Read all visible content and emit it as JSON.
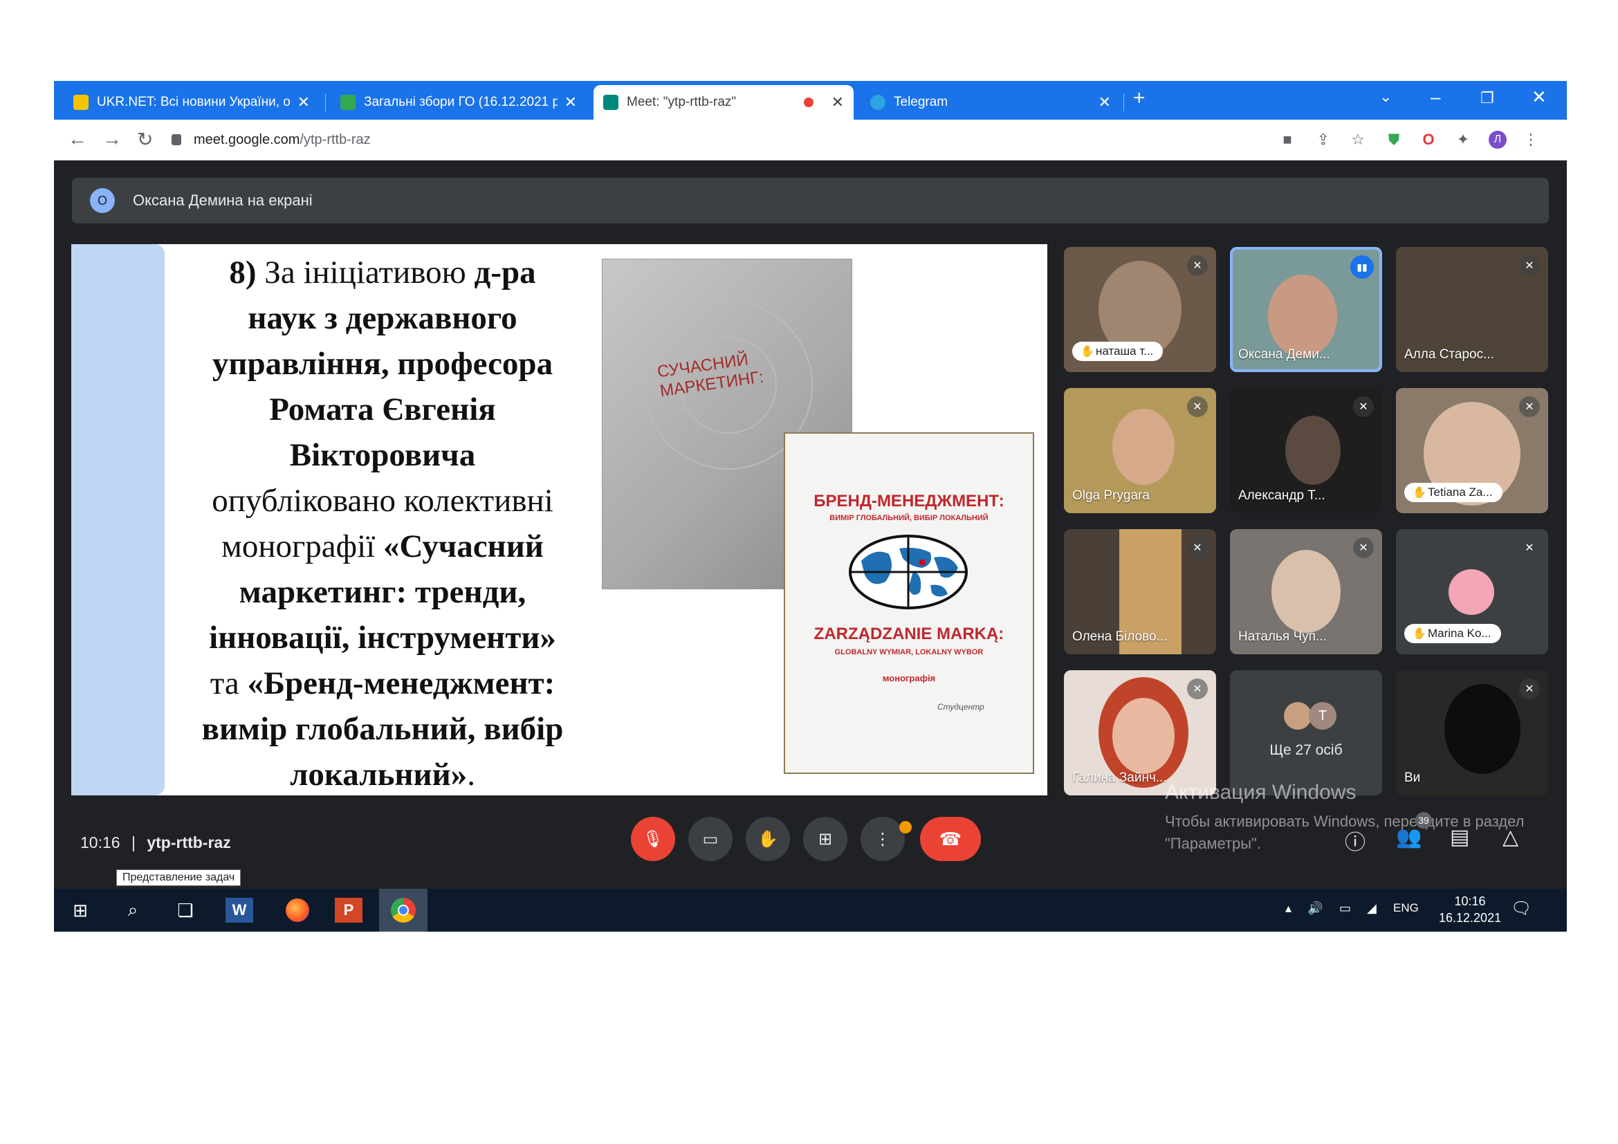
{
  "browser": {
    "tabs": [
      {
        "title": "UKR.NET: Всі новини України, о",
        "favicon_color": "#f5c400"
      },
      {
        "title": "Загальні збори ГО (16.12.2021 р",
        "favicon_color": "#34a853"
      },
      {
        "title": "Meet: \"ytp-rttb-raz\"",
        "favicon_color": "#00897b"
      },
      {
        "title": "Telegram",
        "favicon_color": "#2ca5e0"
      }
    ],
    "url_domain": "meet.google.com",
    "url_path": "/ytp-rttb-raz",
    "new_tab": "+",
    "profile_initial": "Л"
  },
  "meet": {
    "presenter_initial": "О",
    "presenting_text": "Оксана Демина на екрані",
    "time": "10:16",
    "separator": "|",
    "meeting_code": "ytp-rttb-raz",
    "people_count": "39",
    "tooltip": "Представление задач"
  },
  "slide": {
    "lines": [
      {
        "parts": [
          {
            "text": "8)",
            "bold": true
          },
          {
            "text": " За ініціативою ",
            "bold": false
          },
          {
            "text": "д-ра",
            "bold": true
          }
        ]
      },
      {
        "parts": [
          {
            "text": "наук з державного",
            "bold": true
          }
        ]
      },
      {
        "parts": [
          {
            "text": "управління, професора",
            "bold": true
          }
        ]
      },
      {
        "parts": [
          {
            "text": "Ромата Євгенія",
            "bold": true
          }
        ]
      },
      {
        "parts": [
          {
            "text": "Вікторовича",
            "bold": true
          }
        ]
      },
      {
        "parts": [
          {
            "text": "опубліковано колективні",
            "bold": false
          }
        ]
      },
      {
        "parts": [
          {
            "text": "монографії  ",
            "bold": false
          },
          {
            "text": "«Сучасний",
            "bold": true
          }
        ]
      },
      {
        "parts": [
          {
            "text": "маркетинг: тренди,",
            "bold": true
          }
        ]
      },
      {
        "parts": [
          {
            "text": "інновації, інструменти»",
            "bold": true
          }
        ]
      },
      {
        "parts": [
          {
            "text": "та ",
            "bold": false
          },
          {
            "text": "«Бренд-менеджмент:",
            "bold": true
          }
        ]
      },
      {
        "parts": [
          {
            "text": "вимір глобальний, вибір",
            "bold": true
          }
        ]
      },
      {
        "parts": [
          {
            "text": "локальний»",
            "bold": true
          },
          {
            "text": ".",
            "bold": false
          }
        ]
      }
    ],
    "book1": {
      "title": "СУЧАСНИЙ МАРКЕТИНГ:"
    },
    "book2": {
      "title": "БРЕНД-МЕНЕДЖМЕНТ:",
      "subtitle": "ВИМІР ГЛОБАЛЬНИЙ, ВИБІР ЛОКАЛЬНИЙ",
      "title_pl": "ZARZĄDZANIE MARKĄ:",
      "subtitle_pl": "GLOBALNY WYMIAR, LOKALNY WYBOR",
      "genre": "монографія",
      "publisher": "Студцентр"
    }
  },
  "participants": [
    {
      "name": "наташа т...",
      "pill": true
    },
    {
      "name": "Оксана Деми...",
      "pill": false
    },
    {
      "name": "Алла Старос...",
      "pill": false
    },
    {
      "name": "Olga Prygara",
      "pill": false
    },
    {
      "name": "Александр Т...",
      "pill": false
    },
    {
      "name": "Tetiana Za...",
      "pill": true
    },
    {
      "name": "Олена Білово...",
      "pill": false
    },
    {
      "name": "Наталья Чуп...",
      "pill": false
    },
    {
      "name": "Marina Ko...",
      "pill": true
    },
    {
      "name": "Галина Зайнч...",
      "pill": false
    },
    {
      "name": "Ще 27 осіб",
      "pill": false,
      "avatar_letter": "Т"
    },
    {
      "name": "Ви",
      "pill": false
    }
  ],
  "activation": {
    "title": "Активация Windows",
    "body": "Чтобы активировать Windows, перейдите в раздел \"Параметры\"."
  },
  "taskbar": {
    "language": "ENG",
    "time": "10:16",
    "date": "16.12.2021"
  }
}
